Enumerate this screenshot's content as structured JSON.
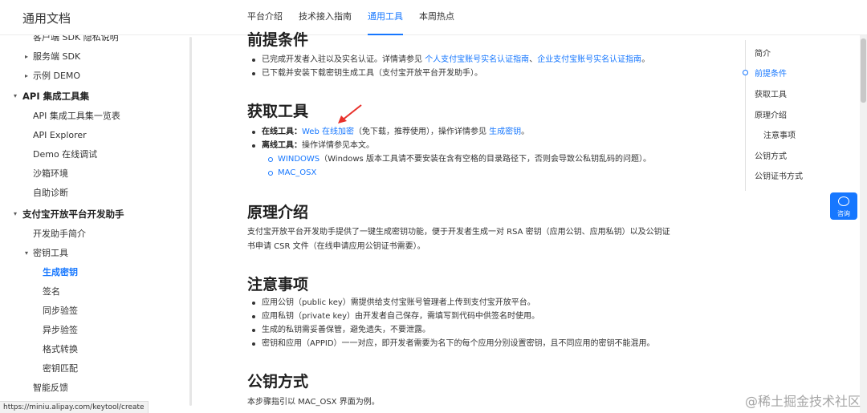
{
  "header": {
    "brand": "通用文档",
    "nav": [
      "平台介绍",
      "技术接入指南",
      "通用工具",
      "本周热点"
    ],
    "active_nav": "通用工具"
  },
  "sidebar": {
    "items": [
      {
        "label": "客户端 SDK 隐私说明",
        "level": 2
      },
      {
        "label": "服务端 SDK",
        "level": 2,
        "arrow": "collapsed"
      },
      {
        "label": "示例 DEMO",
        "level": 2,
        "arrow": "collapsed"
      },
      {
        "label": "API 集成工具集",
        "level": 1,
        "arrow": "expanded"
      },
      {
        "label": "API 集成工具集一览表",
        "level": 2
      },
      {
        "label": "API Explorer",
        "level": 2
      },
      {
        "label": "Demo 在线调试",
        "level": 2
      },
      {
        "label": "沙箱环境",
        "level": 2
      },
      {
        "label": "自助诊断",
        "level": 2
      },
      {
        "label": "支付宝开放平台开发助手",
        "level": 1,
        "arrow": "expanded"
      },
      {
        "label": "开发助手简介",
        "level": 2
      },
      {
        "label": "密钥工具",
        "level": 2,
        "arrow": "expanded"
      },
      {
        "label": "生成密钥",
        "level": 3,
        "active": true
      },
      {
        "label": "签名",
        "level": 3
      },
      {
        "label": "同步验签",
        "level": 3
      },
      {
        "label": "异步验签",
        "level": 3
      },
      {
        "label": "格式转换",
        "level": 3
      },
      {
        "label": "密钥匹配",
        "level": 3
      },
      {
        "label": "智能反馈",
        "level": 2
      }
    ]
  },
  "status_bar": {
    "url": "https://miniu.alipay.com/keytool/create"
  },
  "content": {
    "prereq": {
      "heading": "前提条件",
      "li1_text": "已完成开发者入驻以及实名认证。详情请参见 ",
      "li1_link1": "个人支付宝账号实名认证指南",
      "li1_sep": "、",
      "li1_link2": "企业支付宝账号实名认证指南",
      "li1_end": "。",
      "li2": "已下载并安装下载密钥生成工具（支付宝开放平台开发助手）。"
    },
    "get_tool": {
      "heading": "获取工具",
      "online_label": "在线工具：",
      "online_link": "Web 在线加密",
      "online_mid": "（免下载，推荐使用），操作详情参见 ",
      "online_link2": "生成密钥",
      "online_end": "。",
      "offline_label": "离线工具：",
      "offline_text": "操作详情参见本文。",
      "windows_link": "WINDOWS",
      "windows_note": "（Windows 版本工具请不要安装在含有空格的目录路径下，否则会导致公私钥乱码的问题）。",
      "mac_link": "MAC_OSX"
    },
    "principle": {
      "heading": "原理介绍",
      "para_line1": "支付宝开放平台开发助手提供了一键生成密钥功能，便于开发者生成一对 RSA 密钥（应用公钥、应用私钥）以及公钥证",
      "para_line2": "书申请 CSR 文件（在线申请应用公钥证书需要）。"
    },
    "notes": {
      "heading": "注意事项",
      "items": [
        "应用公钥（public key）需提供给支付宝账号管理者上传到支付宝开放平台。",
        "应用私钥（private key）由开发者自己保存，需填写到代码中供签名时使用。",
        "生成的私钥需妥善保管，避免遗失，不要泄露。",
        "密钥和应用（APPID）一一对应，即开发者需要为名下的每个应用分别设置密钥，且不同应用的密钥不能混用。"
      ]
    },
    "pubkey": {
      "heading": "公钥方式",
      "para": "本步骤指引以 MAC_OSX 界面为例。"
    }
  },
  "toc": {
    "items": [
      "简介",
      "前提条件",
      "获取工具",
      "原理介绍",
      "注意事项",
      "公钥方式",
      "公钥证书方式"
    ],
    "active": "前提条件"
  },
  "help": {
    "label": "咨询"
  },
  "watermark": "@稀土掘金技术社区",
  "colors": {
    "accent": "#1677ff",
    "annotation_arrow": "#e8302a"
  }
}
